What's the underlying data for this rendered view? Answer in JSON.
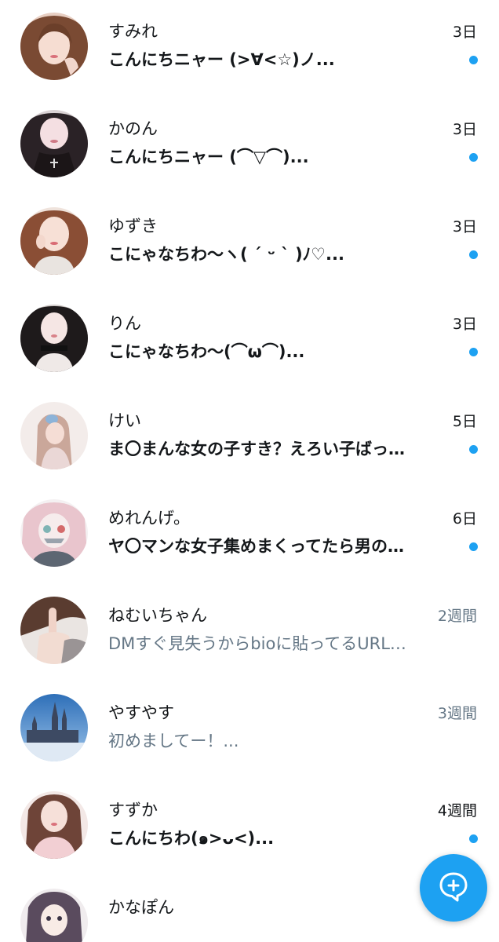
{
  "accent_color": "#1da1f2",
  "read_text_color": "#657786",
  "conversations": [
    {
      "name": "すみれ",
      "time": "3日",
      "preview": "こんにちニャー (>∀<☆)ノ...",
      "unread": true,
      "avatar_icon": "woman-portrait-avatar"
    },
    {
      "name": "かのん",
      "time": "3日",
      "preview": "こんにちニャー (⌒▽⌒)...",
      "unread": true,
      "avatar_icon": "woman-portrait-avatar"
    },
    {
      "name": "ゆずき",
      "time": "3日",
      "preview": "こにゃなちわ〜ヽ( ´ ᵕ ` )ﾉ♡...",
      "unread": true,
      "avatar_icon": "woman-portrait-avatar"
    },
    {
      "name": "りん",
      "time": "3日",
      "preview": "こにゃなちわ〜(⌒ω⌒)...",
      "unread": true,
      "avatar_icon": "woman-portrait-avatar"
    },
    {
      "name": "けい",
      "time": "5日",
      "preview": "ま〇まんな女の子すき？えろい子ばっ…",
      "unread": true,
      "avatar_icon": "woman-portrait-avatar"
    },
    {
      "name": "めれんげ。",
      "time": "6日",
      "preview": "ヤ〇マンな女子集めまくってたら男の…",
      "unread": true,
      "avatar_icon": "anime-illustration-avatar"
    },
    {
      "name": "ねむいちゃん",
      "time": "2週間",
      "preview": "DMすぐ見失うからbioに貼ってるURL…",
      "unread": false,
      "avatar_icon": "hand-photo-avatar"
    },
    {
      "name": "やすやす",
      "time": "3週間",
      "preview": "初めましてー！...",
      "unread": false,
      "avatar_icon": "cathedral-photo-avatar"
    },
    {
      "name": "すずか",
      "time": "4週間",
      "preview": "こんにちわ(๑>ᴗ<)...",
      "unread": true,
      "avatar_icon": "woman-portrait-avatar"
    },
    {
      "name": "かなぽん",
      "time": "",
      "preview": "",
      "unread": false,
      "avatar_icon": "anime-illustration-avatar"
    }
  ],
  "fab": {
    "icon": "new-message-icon"
  }
}
